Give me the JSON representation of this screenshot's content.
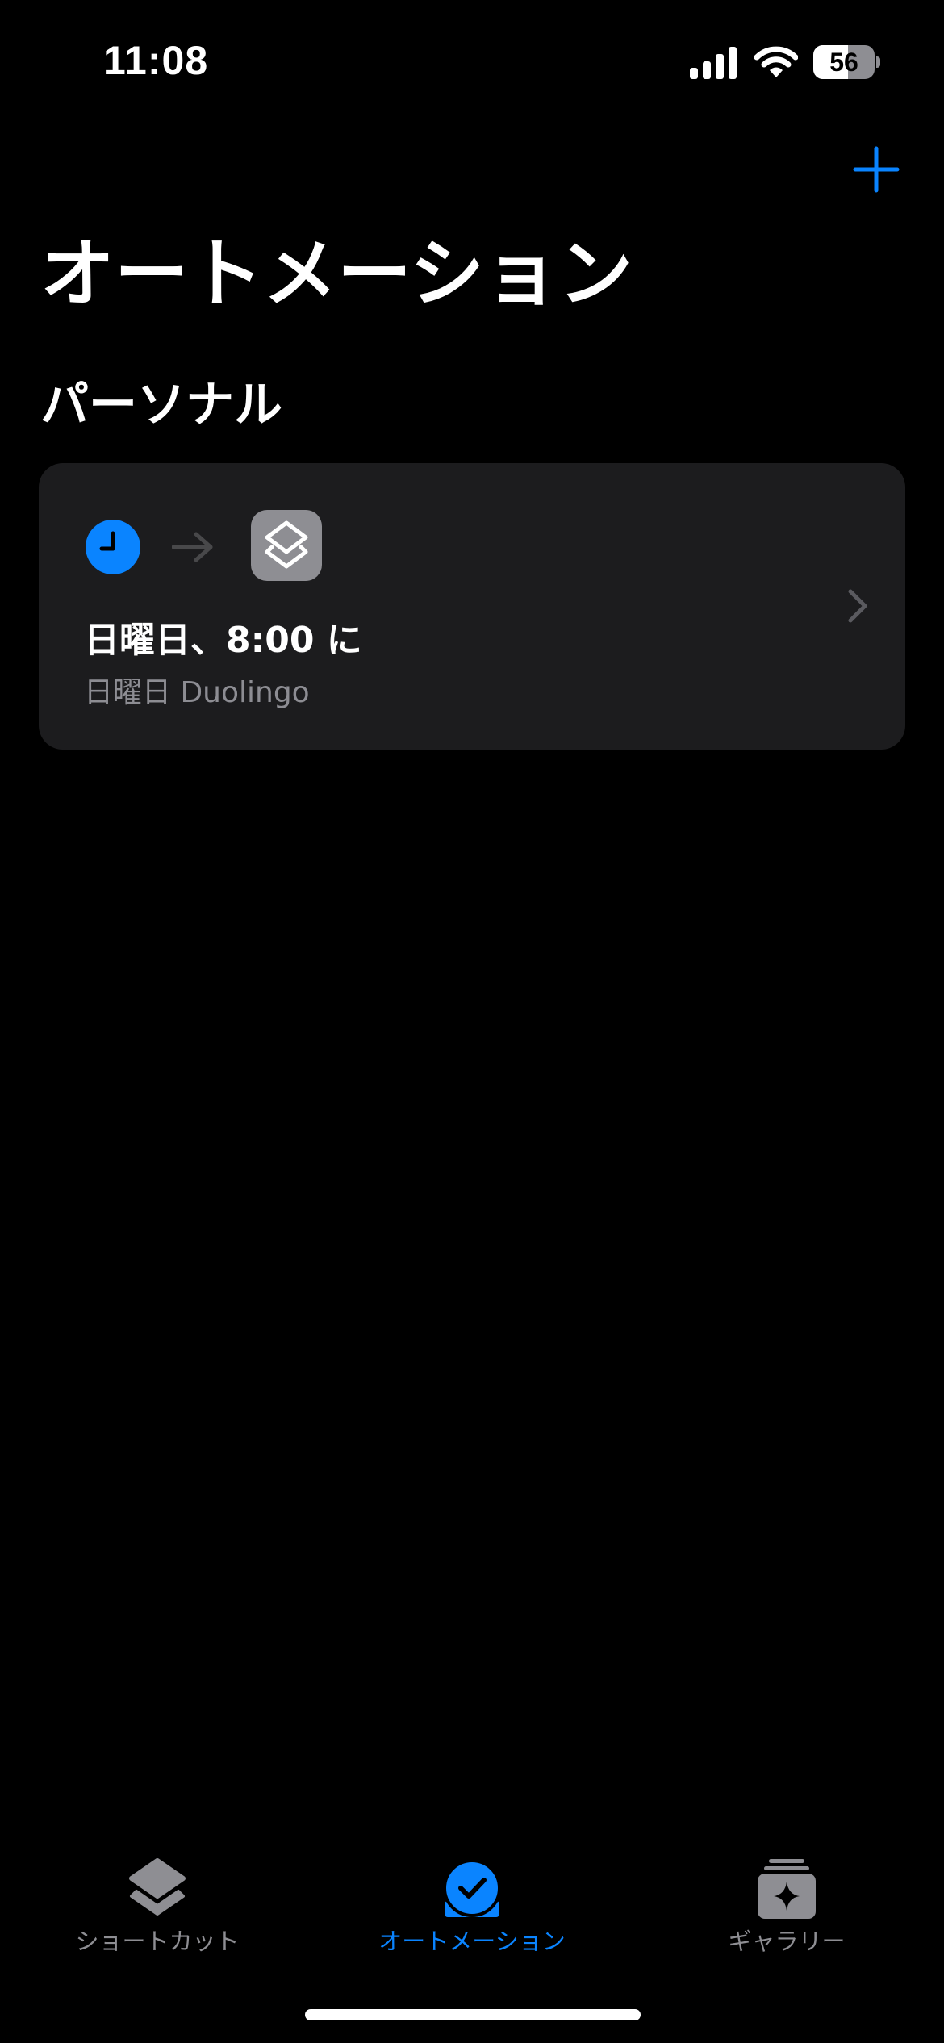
{
  "status_bar": {
    "time": "11:08",
    "battery_level": "56",
    "battery_fraction": 0.56
  },
  "colors": {
    "accent": "#0a84ff",
    "background": "#000000",
    "card": "#1c1c1e",
    "secondary_text": "#8d8d93",
    "inactive_tab": "#8e8e93"
  },
  "header": {
    "add_icon": "plus-icon",
    "title": "オートメーション"
  },
  "section": {
    "title": "パーソナル"
  },
  "automations": [
    {
      "trigger_icon": "clock-icon",
      "arrow_icon": "arrow-right-icon",
      "action_icon": "shortcuts-app-icon",
      "title": "日曜日、8:00 に",
      "subtitle": "日曜日 Duolingo",
      "chevron_icon": "chevron-right-icon"
    }
  ],
  "tab_bar": {
    "tabs": [
      {
        "label": "ショートカット",
        "icon": "shortcuts-stack-icon",
        "active": false
      },
      {
        "label": "オートメーション",
        "icon": "automation-check-icon",
        "active": true
      },
      {
        "label": "ギャラリー",
        "icon": "gallery-sparkle-icon",
        "active": false
      }
    ]
  }
}
